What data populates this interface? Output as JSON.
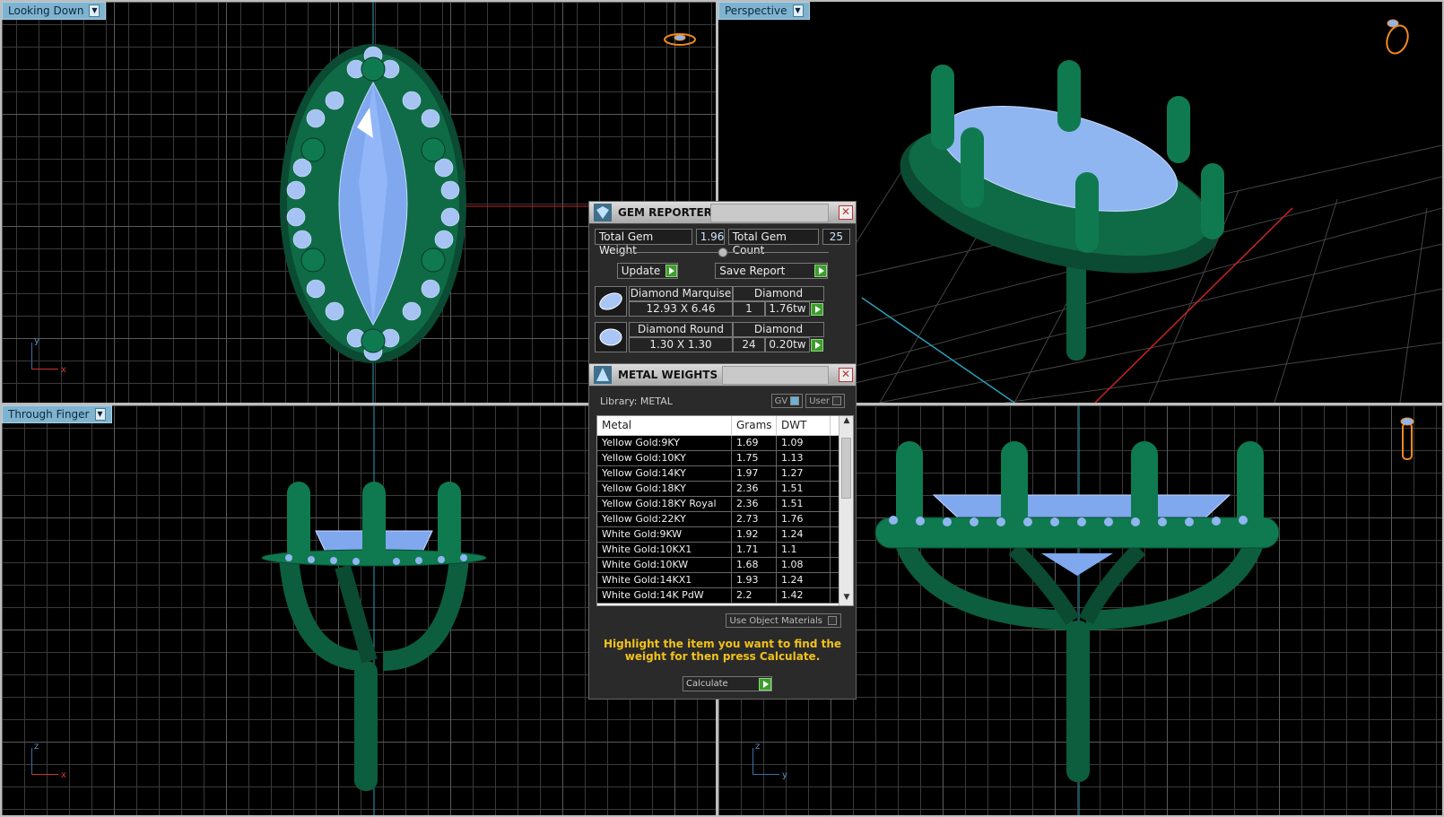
{
  "viewports": {
    "top_left": {
      "label": "Looking Down",
      "axes": {
        "vertical": "y",
        "horizontal": "x"
      }
    },
    "top_right": {
      "label": "Perspective"
    },
    "bottom_left": {
      "label": "Through Finger",
      "axes": {
        "vertical": "z",
        "horizontal": "x"
      }
    },
    "bottom_right": {
      "label": "",
      "axes": {
        "vertical": "z",
        "horizontal": "y"
      }
    }
  },
  "gem_reporter": {
    "title": "GEM REPORTER",
    "total_weight_label": "Total Gem Weight",
    "total_weight_value": "1.96",
    "total_count_label": "Total Gem Count",
    "total_count_value": "25",
    "update_label": "Update",
    "save_report_label": "Save Report",
    "gems": [
      {
        "name": "Diamond Marquise",
        "material": "Diamond",
        "size": "12.93 X 6.46",
        "count": "1",
        "weight": "1.76tw"
      },
      {
        "name": "Diamond Round",
        "material": "Diamond",
        "size": "1.30 X 1.30",
        "count": "24",
        "weight": "0.20tw"
      }
    ]
  },
  "metal_weights": {
    "title": "METAL WEIGHTS",
    "library_label": "Library: METAL",
    "gv_label": "GV",
    "user_label": "User",
    "columns": [
      "Metal",
      "Grams",
      "DWT"
    ],
    "rows": [
      [
        "Yellow Gold:9KY",
        "1.69",
        "1.09"
      ],
      [
        "Yellow Gold:10KY",
        "1.75",
        "1.13"
      ],
      [
        "Yellow Gold:14KY",
        "1.97",
        "1.27"
      ],
      [
        "Yellow Gold:18KY",
        "2.36",
        "1.51"
      ],
      [
        "Yellow Gold:18KY Royal",
        "2.36",
        "1.51"
      ],
      [
        "Yellow Gold:22KY",
        "2.73",
        "1.76"
      ],
      [
        "White Gold:9KW",
        "1.92",
        "1.24"
      ],
      [
        "White Gold:10KX1",
        "1.71",
        "1.1"
      ],
      [
        "White Gold:10KW",
        "1.68",
        "1.08"
      ],
      [
        "White Gold:14KX1",
        "1.93",
        "1.24"
      ],
      [
        "White Gold:14K PdW",
        "2.2",
        "1.42"
      ]
    ],
    "use_object_materials_label": "Use Object Materials",
    "hint": "Highlight the item you want to find the weight for then press Calculate.",
    "calculate_label": "Calculate"
  },
  "colors": {
    "metal": "#0e6b46",
    "gem": "#8fb6f0",
    "label_bg": "#7fb3cf",
    "hint": "#f2c21b"
  }
}
